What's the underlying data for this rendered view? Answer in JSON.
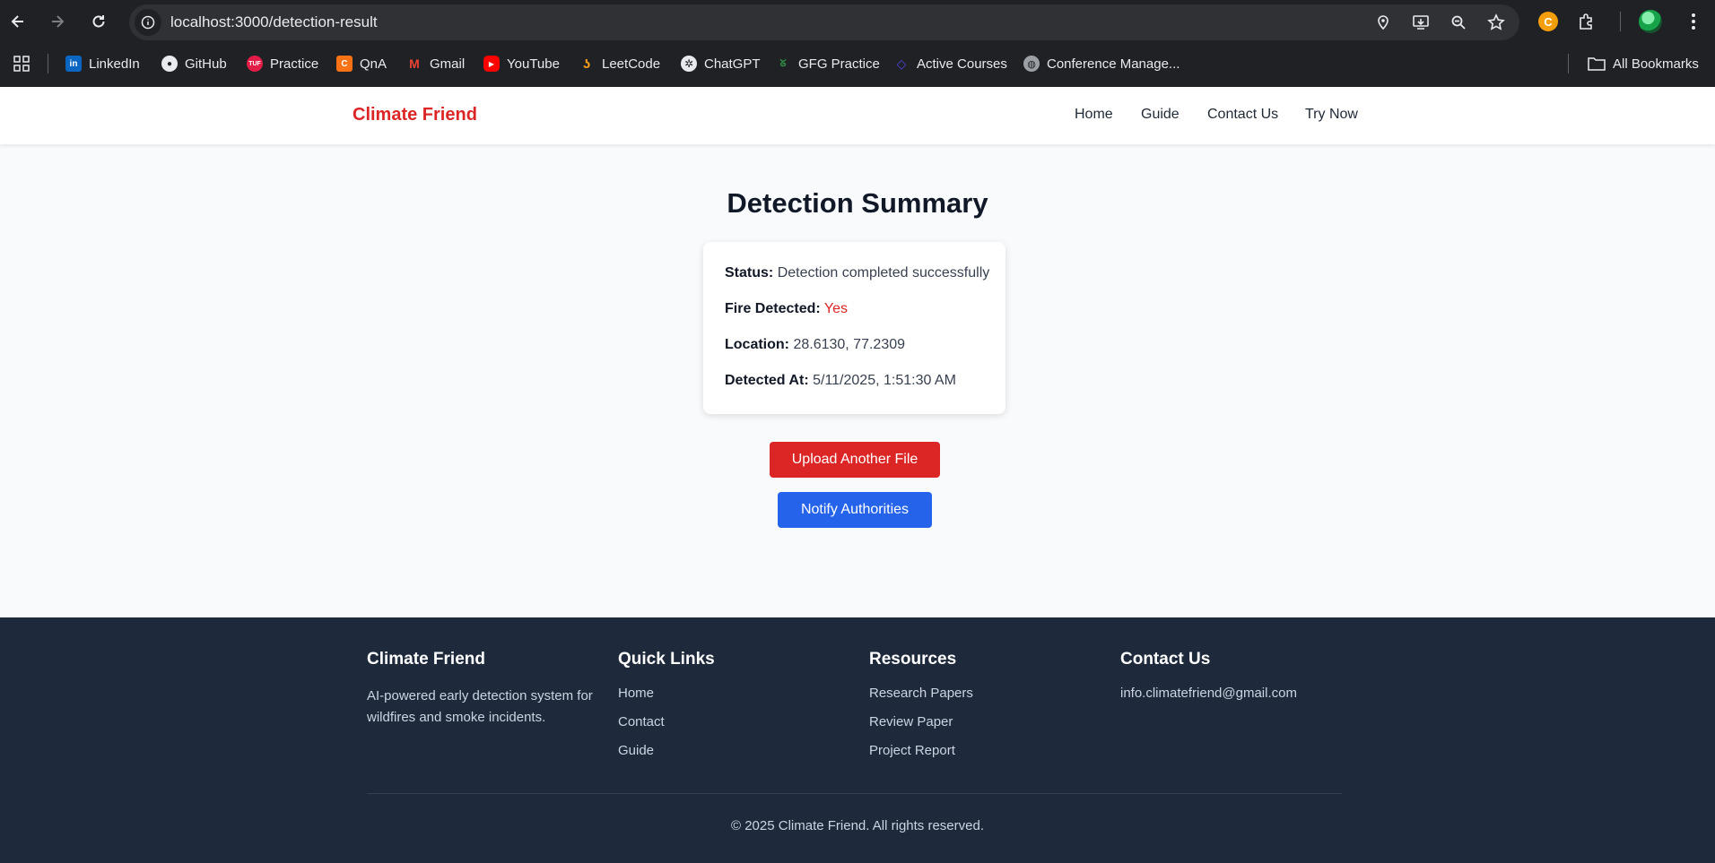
{
  "browser": {
    "url": "localhost:3000/detection-result",
    "bookmarks": [
      {
        "label": "LinkedIn",
        "icon": "linkedin-icon",
        "color": "#0a66c2"
      },
      {
        "label": "GitHub",
        "icon": "github-icon",
        "color": "#e8eaed"
      },
      {
        "label": "Practice",
        "icon": "tuf-icon",
        "color": "#e11d48"
      },
      {
        "label": "QnA",
        "icon": "qna-icon",
        "color": "#f97316"
      },
      {
        "label": "Gmail",
        "icon": "gmail-icon",
        "color": "#ea4335"
      },
      {
        "label": "YouTube",
        "icon": "youtube-icon",
        "color": "#ff0000"
      },
      {
        "label": "LeetCode",
        "icon": "leetcode-icon",
        "color": "#f89f1b"
      },
      {
        "label": "ChatGPT",
        "icon": "chatgpt-icon",
        "color": "#e8eaed"
      },
      {
        "label": "GFG Practice",
        "icon": "gfg-icon",
        "color": "#2f8d46"
      },
      {
        "label": "Active Courses",
        "icon": "courses-icon",
        "color": "#4f46e5"
      },
      {
        "label": "Conference Manage...",
        "icon": "globe-icon",
        "color": "#9aa0a6"
      }
    ],
    "all_bookmarks": "All Bookmarks"
  },
  "nav": {
    "brand": "Climate Friend",
    "links": [
      "Home",
      "Guide",
      "Contact Us",
      "Try Now"
    ]
  },
  "main": {
    "title": "Detection Summary",
    "status_label": "Status:",
    "status_value": "Detection completed successfully",
    "fire_label": "Fire Detected:",
    "fire_value": "Yes",
    "location_label": "Location:",
    "location_value": "28.6130, 77.2309",
    "detected_label": "Detected At:",
    "detected_value": "5/11/2025, 1:51:30 AM",
    "upload_button": "Upload Another File",
    "notify_button": "Notify Authorities"
  },
  "footer": {
    "brand": "Climate Friend",
    "description": "AI-powered early detection system for wildfires and smoke incidents.",
    "quick_links_title": "Quick Links",
    "quick_links": [
      "Home",
      "Contact",
      "Guide"
    ],
    "resources_title": "Resources",
    "resources": [
      "Research Papers",
      "Review Paper",
      "Project Report"
    ],
    "contact_title": "Contact Us",
    "email": "info.climatefriend@gmail.com",
    "copyright": "© 2025 Climate Friend. All rights reserved."
  },
  "colors": {
    "brand": "#dc2626",
    "primary_blue": "#2563eb",
    "footer_bg": "#1e293b"
  }
}
